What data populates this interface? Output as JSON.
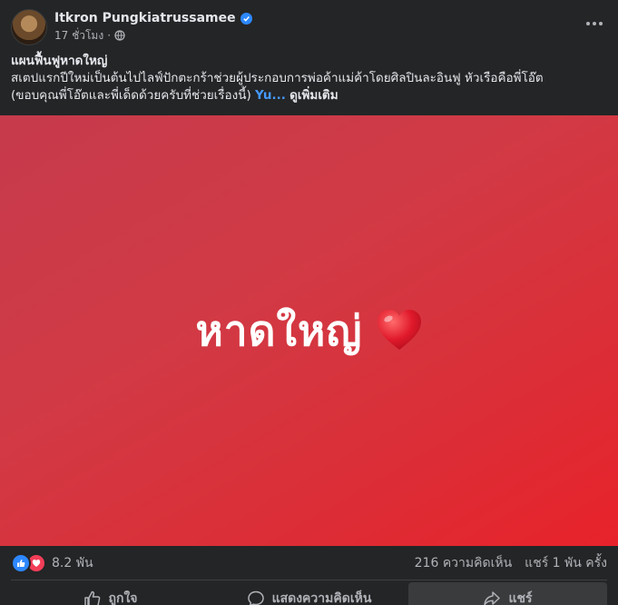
{
  "post": {
    "author": "Itkron Pungkiatrussamee",
    "time": "17 ชั่วโมง",
    "dot": "·",
    "caption": {
      "title": "แผนฟื้นฟูหาดใหญ่",
      "line2": "สเตปแรกปีใหม่เป็นต้นไปไลฟ์ปักตะกร้าช่วยผู้ประกอบการพ่อค้าแม่ค้าโดยศิลปินละอินฟู หัวเรือคือพี่โอ๊ต",
      "line3": "(ขอบคุณพี่โอ๊ตและพี่เด็ดด้วยครับที่ช่วยเรื่องนี้)",
      "link": "Yu...",
      "see_more": "ดูเพิ่มเติม"
    },
    "media_text": "หาดใหญ่",
    "reactions_count": "8.2 พัน",
    "comments": "216 ความคิดเห็น",
    "shares": "แชร์ 1 พัน ครั้ง",
    "actions": {
      "like": "ถูกใจ",
      "comment": "แสดงความคิดเห็น",
      "share": "แชร์"
    }
  },
  "icons": {
    "verified": "verified-badge-icon",
    "privacy": "globe-icon",
    "more": "more-options-icon",
    "heart": "heart-emoji-icon",
    "like": "thumbs-up-icon",
    "comment": "comment-bubble-icon",
    "share": "share-arrow-icon"
  },
  "colors": {
    "background": "#242526",
    "accent": "#2d88ff",
    "link": "#4599ff",
    "media_red": "#e8222a"
  }
}
